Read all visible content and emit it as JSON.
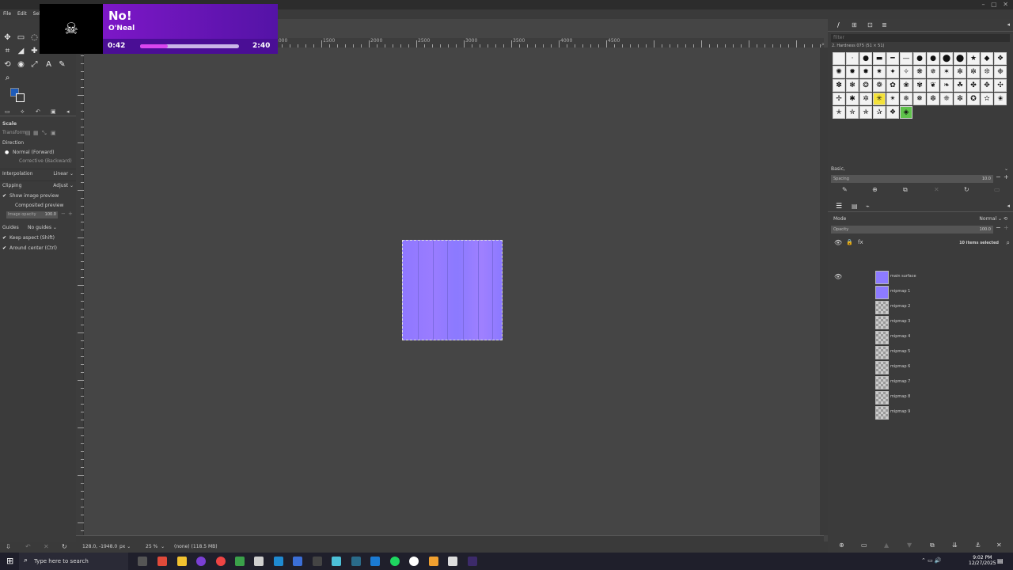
{
  "menu": [
    "File",
    "Edit",
    "Select"
  ],
  "tool_options": {
    "title": "Scale",
    "transform_label": "Transform",
    "direction_label": "Direction",
    "direction_normal": "Normal (Forward)",
    "direction_corrective": "Corrective (Backward)",
    "interpolation_label": "Interpolation",
    "interpolation_value": "Linear",
    "clipping_label": "Clipping",
    "clipping_value": "Adjust",
    "show_image_preview": "Show image preview",
    "composited_preview": "Composited preview",
    "image_opacity_label": "Image opacity",
    "image_opacity_value": "100.0",
    "guides_label": "Guides",
    "guides_value": "No guides",
    "keep_aspect": "Keep aspect (Shift)",
    "around_center": "Around center (Ctrl)"
  },
  "ruler": {
    "h_labels": [
      "-1000",
      "-500",
      "0",
      "500",
      "1000",
      "1500",
      "2000",
      "2500",
      "3000",
      "3500",
      "4000",
      "4500"
    ]
  },
  "statusbar": {
    "coords": "128.0, -1948.0",
    "unit": "px",
    "zoom": "25 %",
    "info": "(none) (118.5 MB)"
  },
  "brushes_panel": {
    "filter_placeholder": "filter",
    "brush_name": "2. Hardness 075 (51 × 51)",
    "tag": "Basic,",
    "spacing_label": "Spacing",
    "spacing_value": "10.0"
  },
  "layers_panel": {
    "mode_label": "Mode",
    "mode_value": "Normal",
    "opacity_label": "Opacity",
    "opacity_value": "100.0",
    "selected_info": "10 items selected",
    "layers": [
      {
        "name": "main surface",
        "visible": true,
        "color": "#8d7bff"
      },
      {
        "name": "mipmap 1",
        "visible": false,
        "color": "#8d7bff"
      },
      {
        "name": "mipmap 2",
        "visible": false
      },
      {
        "name": "mipmap 3",
        "visible": false
      },
      {
        "name": "mipmap 4",
        "visible": false
      },
      {
        "name": "mipmap 5",
        "visible": false
      },
      {
        "name": "mipmap 6",
        "visible": false
      },
      {
        "name": "mipmap 7",
        "visible": false
      },
      {
        "name": "mipmap 8",
        "visible": false
      },
      {
        "name": "mipmap 9",
        "visible": false
      }
    ]
  },
  "now_playing": {
    "title": "No!",
    "artist": "O'Neal",
    "elapsed": "0:42",
    "total": "2:40",
    "progress": 0.28,
    "accent": "#d946ef"
  },
  "taskbar": {
    "search_placeholder": "Type here to search",
    "time": "9:02 PM",
    "date": "12/27/2025"
  },
  "colors": {
    "foreground": "#1e5bb8",
    "background": "#ffffff"
  }
}
